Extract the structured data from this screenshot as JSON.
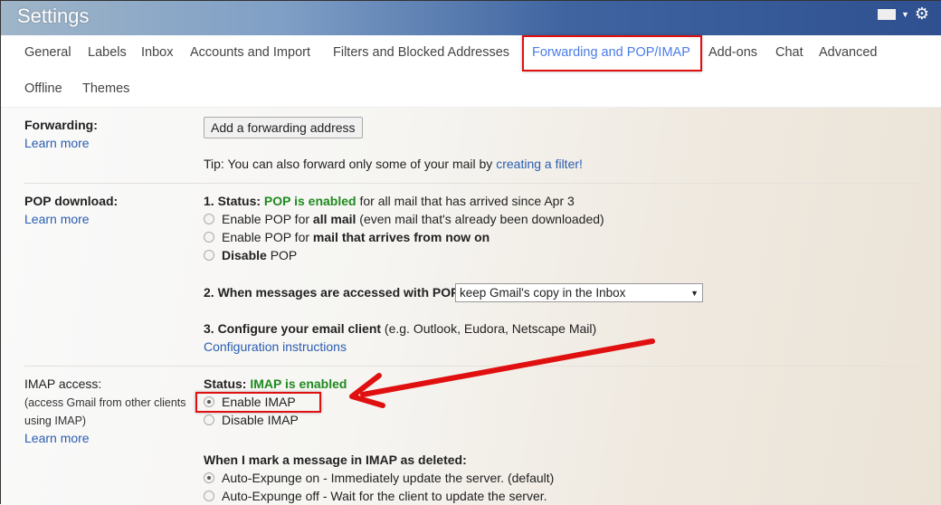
{
  "header": {
    "title": "Settings",
    "keyboard_icon": "keyboard-icon",
    "gear_icon": "gear-icon"
  },
  "tabs": [
    "General",
    "Labels",
    "Inbox",
    "Accounts and Import",
    "Filters and Blocked Addresses",
    "Forwarding and POP/IMAP",
    "Add-ons",
    "Chat",
    "Advanced",
    "Offline",
    "Themes"
  ],
  "active_tab": "Forwarding and POP/IMAP",
  "forwarding": {
    "label": "Forwarding:",
    "learn_more": "Learn more",
    "button": "Add a forwarding address",
    "tip": "Tip: You can also forward only some of your mail by ",
    "tip_link": "creating a filter!"
  },
  "pop": {
    "label": "POP download:",
    "learn_more": "Learn more",
    "status_prefix": "1. Status: ",
    "status": "POP is enabled",
    "status_suffix": " for all mail that has arrived since Apr 3",
    "opt1_a": "Enable POP for ",
    "opt1_b": "all mail",
    "opt1_c": " (even mail that's already been downloaded)",
    "opt2_a": "Enable POP for ",
    "opt2_b": "mail that arrives from now on",
    "opt3_a": "Disable",
    "opt3_b": " POP",
    "step2": "2. When messages are accessed with POP",
    "select_value": "keep Gmail's copy in the Inbox",
    "step3": "3. Configure your email client",
    "step3_note": " (e.g. Outlook, Eudora, Netscape Mail)",
    "config_link": "Configuration instructions"
  },
  "imap": {
    "label": "IMAP access:",
    "desc1": "(access Gmail from other clients",
    "desc2": "using IMAP)",
    "learn_more": "Learn more",
    "status_prefix": "Status: ",
    "status": "IMAP is enabled",
    "enable": "Enable IMAP",
    "disable": "Disable IMAP",
    "selected": "Enable IMAP",
    "deleted_heading": "When I mark a message in IMAP as deleted:",
    "expunge_on": "Auto-Expunge on - Immediately update the server. (default)",
    "expunge_off": "Auto-Expunge off - Wait for the client to update the server."
  },
  "colors": {
    "accent": "#4a7ce8",
    "status_green": "#1f8a1f",
    "annotation_red": "#e01010"
  }
}
